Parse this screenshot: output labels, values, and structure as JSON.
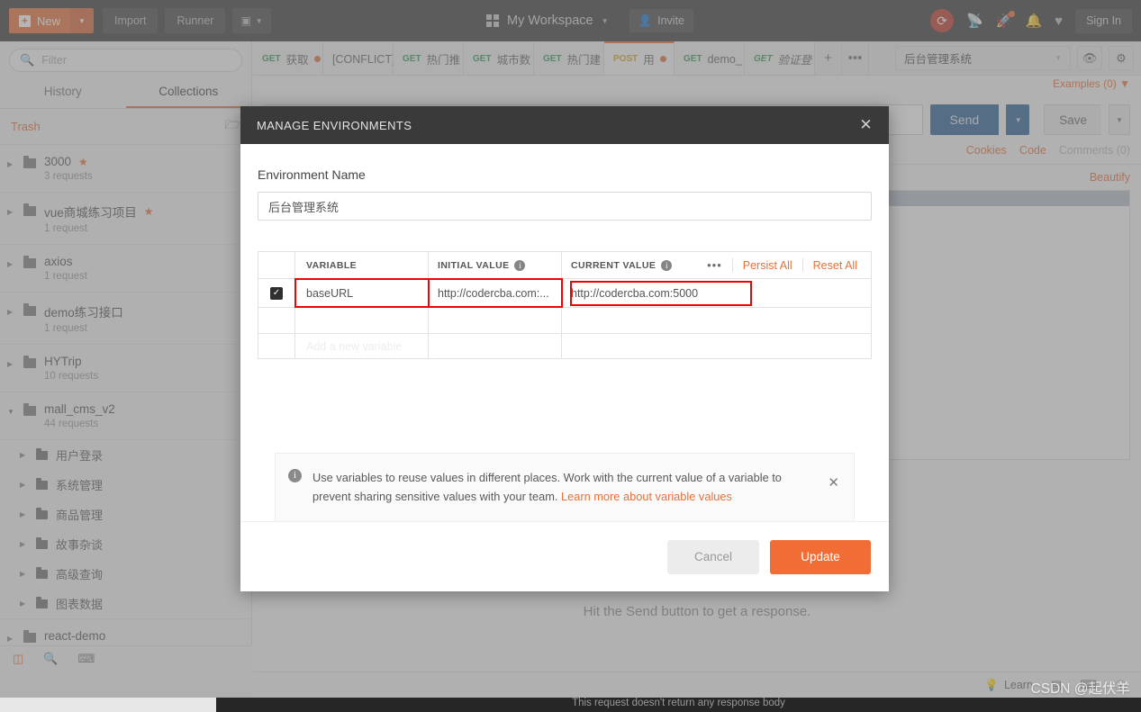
{
  "topbar": {
    "new_label": "New",
    "import_label": "Import",
    "runner_label": "Runner",
    "workspace_name": "My Workspace",
    "invite_label": "Invite",
    "signin_label": "Sign In",
    "accent_color": "#e8703a",
    "background_color": "#3a3a3a"
  },
  "sidebar": {
    "filter_placeholder": "Filter",
    "tabs": [
      {
        "label": "History",
        "active": false
      },
      {
        "label": "Collections",
        "active": true
      }
    ],
    "trash_label": "Trash",
    "collections": [
      {
        "name": "3000",
        "requests": "3 requests",
        "starred": true,
        "expanded": false
      },
      {
        "name": "vue商城练习项目",
        "requests": "1 request",
        "starred": true,
        "expanded": false
      },
      {
        "name": "axios",
        "requests": "1 request",
        "starred": false,
        "expanded": false
      },
      {
        "name": "demo练习接口",
        "requests": "1 request",
        "starred": false,
        "expanded": false
      },
      {
        "name": "HYTrip",
        "requests": "10 requests",
        "starred": false,
        "expanded": false
      },
      {
        "name": "mall_cms_v2",
        "requests": "44 requests",
        "starred": false,
        "expanded": true
      }
    ],
    "subfolders": [
      "用户登录",
      "系统管理",
      "商品管理",
      "故事杂谈",
      "高级查询",
      "图表数据"
    ],
    "next_collection": "react-demo"
  },
  "main": {
    "request_tabs": [
      {
        "method": "GET",
        "name": "获取",
        "dirty": true,
        "active": false
      },
      {
        "method": "",
        "name": "[CONFLICT]",
        "dirty": false,
        "active": false
      },
      {
        "method": "GET",
        "name": "热门推",
        "dirty": false,
        "active": false
      },
      {
        "method": "GET",
        "name": "城市数",
        "dirty": false,
        "active": false
      },
      {
        "method": "GET",
        "name": "热门建",
        "dirty": false,
        "active": false
      },
      {
        "method": "POST",
        "name": "用",
        "dirty": true,
        "active": true
      },
      {
        "method": "GET",
        "name": "demo_",
        "dirty": false,
        "active": false
      },
      {
        "method": "GET",
        "name": "验证登",
        "dirty": false,
        "active": false
      }
    ],
    "tab_add": "+",
    "tab_more": "•••",
    "environment_selected": "后台管理系统",
    "examples_label": "Examples (0)",
    "send_label": "Send",
    "save_label": "Save",
    "links": [
      {
        "label": "Cookies",
        "muted": false
      },
      {
        "label": "Code",
        "muted": false
      },
      {
        "label": "Comments (0)",
        "muted": true
      }
    ],
    "beautify_label": "Beautify",
    "response_placeholder": "Hit the Send button to get a response.",
    "learn_label": "Learn",
    "send_color": "#2b5f94"
  },
  "modal": {
    "title": "MANAGE ENVIRONMENTS",
    "env_name_label": "Environment Name",
    "env_name_value": "后台管理系统",
    "table": {
      "headers": {
        "variable": "VARIABLE",
        "initial_value": "INITIAL VALUE",
        "current_value": "CURRENT VALUE"
      },
      "persist_all": "Persist All",
      "reset_all": "Reset All",
      "more": "•••",
      "rows": [
        {
          "checked": true,
          "variable": "baseURL",
          "initial_value": "http://codercba.com:...",
          "current_value": "http://codercba.com:5000"
        }
      ],
      "add_placeholder": "Add a new variable"
    },
    "banner": {
      "text": "Use variables to reuse values in different places. Work with the current value of a variable to prevent sharing sensitive values with your team.",
      "link": "Learn more about variable values"
    },
    "cancel_label": "Cancel",
    "update_label": "Update",
    "highlight_color": "#f50000",
    "update_color": "#f26c35"
  },
  "footer": {
    "response_note": "This request doesn't return any response body",
    "watermark": "CSDN @起伏羊"
  }
}
